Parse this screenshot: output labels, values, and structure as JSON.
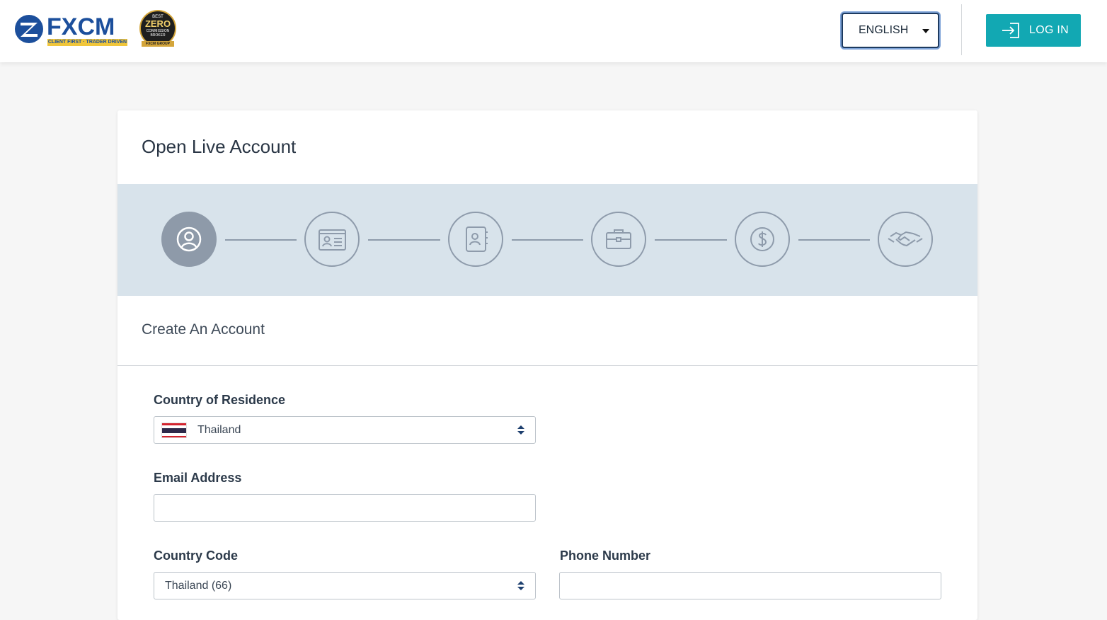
{
  "header": {
    "brand": "FXCM",
    "tagline": "CLIENT FIRST · TRADER DRIVEN",
    "badge": {
      "line1": "BEST",
      "line2": "ZERO",
      "line3": "COMMISSION BROKER",
      "line4": "FXCM GROUP"
    },
    "language": "ENGLISH",
    "login_label": "LOG IN",
    "colors": {
      "brand_blue": "#1c4f9c",
      "login_bg": "#12a8b3"
    }
  },
  "card": {
    "title": "Open Live Account",
    "steps": [
      {
        "icon": "user-icon",
        "active": true
      },
      {
        "icon": "id-card-icon",
        "active": false
      },
      {
        "icon": "contact-book-icon",
        "active": false
      },
      {
        "icon": "briefcase-icon",
        "active": false
      },
      {
        "icon": "dollar-icon",
        "active": false
      },
      {
        "icon": "handshake-icon",
        "active": false
      }
    ],
    "section_title": "Create An Account",
    "fields": {
      "country_of_residence": {
        "label": "Country of Residence",
        "value": "Thailand"
      },
      "email": {
        "label": "Email Address",
        "value": "",
        "placeholder": ""
      },
      "country_code": {
        "label": "Country Code",
        "value": "Thailand (66)"
      },
      "phone": {
        "label": "Phone Number",
        "value": "",
        "placeholder": ""
      }
    }
  }
}
